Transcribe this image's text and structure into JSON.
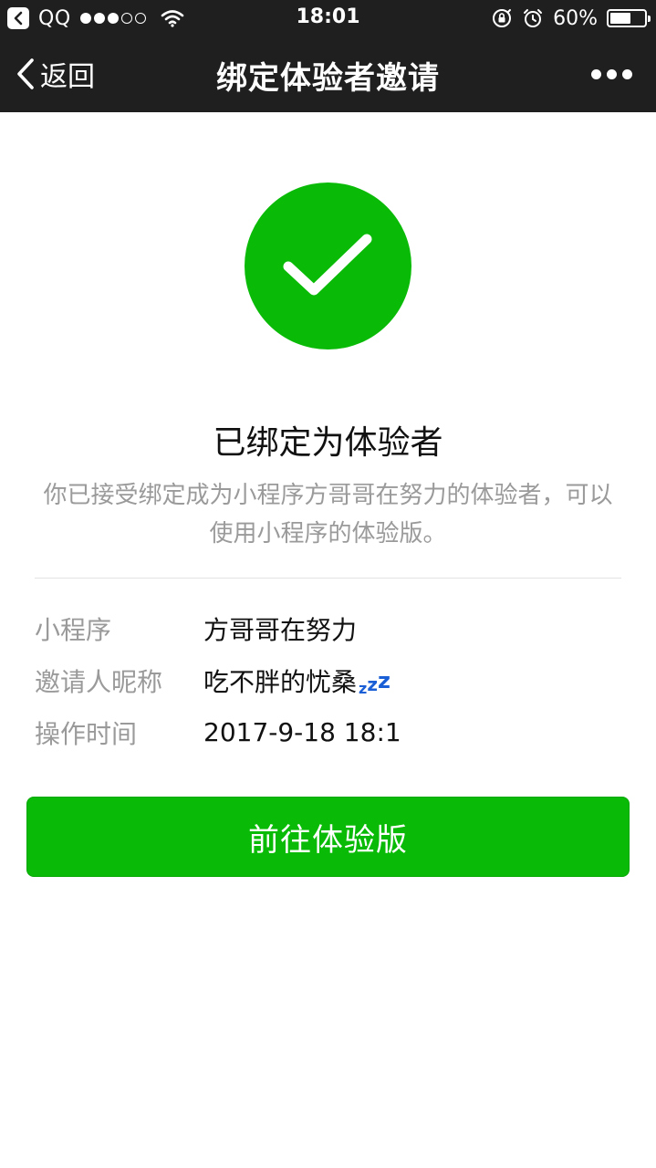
{
  "status_bar": {
    "carrier": "QQ",
    "time": "18:01",
    "battery_percent": "60%",
    "icons": [
      "back-to-app-icon",
      "signal-icon",
      "wifi-icon",
      "rotation-lock-icon",
      "alarm-icon",
      "battery-icon"
    ]
  },
  "nav": {
    "back_label": "返回",
    "title": "绑定体验者邀请",
    "more_icon": "more-icon"
  },
  "result": {
    "icon": "check-circle-icon",
    "icon_color": "#09bb07",
    "title": "已绑定为体验者",
    "description": "你已接受绑定成为小程序方哥哥在努力的体验者，可以使用小程序的体验版。"
  },
  "info": {
    "rows": [
      {
        "label": "小程序",
        "value": "方哥哥在努力"
      },
      {
        "label": "邀请人昵称",
        "value": "吃不胖的忧桑"
      },
      {
        "label": "操作时间",
        "value": "2017-9-18 18:1"
      }
    ],
    "sleep_icon": "zzz-icon"
  },
  "action": {
    "button_label": "前往体验版",
    "button_color": "#09bb07"
  }
}
